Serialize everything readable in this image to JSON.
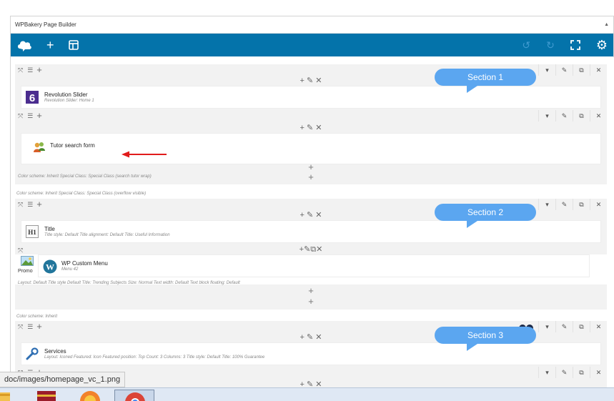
{
  "builder": {
    "title": "WPBakery Page Builder",
    "collapse_glyph": "▲"
  },
  "toolbar": {
    "logo_icon": "cloud-logo-icon",
    "add_glyph": "+",
    "templates_glyph": "⊟",
    "undo_glyph": "↺",
    "redo_glyph": "↻",
    "fullscreen_glyph": "⛶",
    "settings_glyph": "⚙"
  },
  "controls": {
    "move_glyph": "⤧",
    "drag_glyph": "☰",
    "add_glyph": "+",
    "toggle_glyph": "▾",
    "edit_glyph": "✎",
    "clone_glyph": "⧉",
    "delete_glyph": "✕",
    "column_controls": "+ ✎ ✕",
    "column_controls_dense": "+✎⧉✕",
    "add_element": "+"
  },
  "callouts": {
    "section1": "Section 1",
    "section2": "Section 2",
    "section3": "Section 3"
  },
  "section1": {
    "element1": {
      "name": "Revolution Slider",
      "sub": "Revolution Slider: Home 1"
    },
    "inner_element": {
      "name": "Tutor search form"
    },
    "inner_meta": "Color scheme: Inherit  Special Class: Special Class (search tutor wrap)",
    "row_meta": "Color scheme: Inherit  Special Class: Special Class (overflow visible)"
  },
  "section2": {
    "title_element": {
      "name": "Title",
      "sub": "Title style: Default  Title alignment: Default  Title: Useful Information",
      "icon_text": "H1"
    },
    "promo_label": "Promo",
    "menu_element": {
      "name": "WP Custom Menu",
      "sub": "Menu 42"
    },
    "inner_meta": "Layout: Default  Title style Default  Title: Trending Subjects  Size: Normal  Text width: Default  Text block floating: Default",
    "row_meta": "Color scheme: Inherit"
  },
  "section3": {
    "services_element": {
      "name": "Services",
      "sub": "Layout: Iconed  Featured: Icon  Featured position: Top  Count: 3  Columns: 3  Title style: Default  Title: 100% Guarantee"
    }
  },
  "status_bar": {
    "url": "doc/images/homepage_vc_1.png"
  },
  "colors": {
    "toolbar_bg": "#0473aa",
    "callout_bg": "#5ba6f0",
    "arrow": "#e11b1b"
  }
}
